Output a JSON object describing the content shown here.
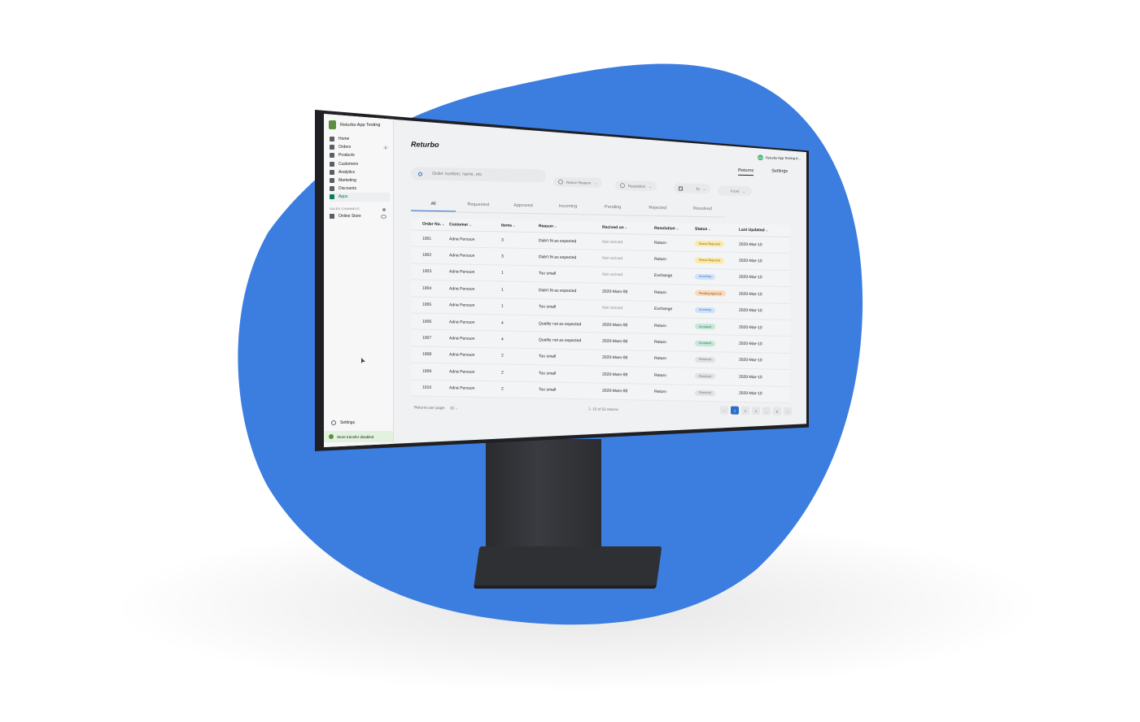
{
  "theme": {
    "blob": "#3c7de0",
    "accent": "#2c6ecb",
    "shopify_green": "#008060"
  },
  "admin": {
    "store_name": "Returbo App Testing",
    "nav": [
      {
        "label": "Home",
        "icon": "home-icon"
      },
      {
        "label": "Orders",
        "icon": "orders-icon",
        "badge": "1"
      },
      {
        "label": "Products",
        "icon": "tag-icon"
      },
      {
        "label": "Customers",
        "icon": "person-icon"
      },
      {
        "label": "Analytics",
        "icon": "bar-chart-icon"
      },
      {
        "label": "Marketing",
        "icon": "megaphone-icon"
      },
      {
        "label": "Discounts",
        "icon": "discount-icon"
      },
      {
        "label": "Apps",
        "icon": "apps-icon",
        "active": true
      }
    ],
    "sales_channels_title": "SALES CHANNELS",
    "online_store": "Online Store",
    "settings": "Settings",
    "transfer_notice": "Store transfer disabled"
  },
  "app": {
    "brand": "Returbo",
    "user_initials": "RA",
    "user_name": "Returbo App Testing A...",
    "top_tabs": [
      "Returns",
      "Settings"
    ],
    "search_placeholder": "Order number, name, etc",
    "filters": {
      "return_reason": "Return Reason",
      "resolution": "Resolution",
      "to": "To",
      "from": "From"
    },
    "tabs": [
      "All",
      "Requested",
      "Approved",
      "Incoming",
      "Pending",
      "Rejected",
      "Resolved"
    ],
    "columns": [
      "Order No.",
      "Customer",
      "Items",
      "Reason",
      "Recived on",
      "Resolution",
      "Status",
      "Last Updated"
    ],
    "rows": [
      {
        "order": "1001",
        "customer": "Adna Persson",
        "items": "3",
        "reason": "Didn't fit as expected",
        "received": "Not recived",
        "resolution": "Return",
        "status": "Return Rejected",
        "updated": "2020-Mar-10"
      },
      {
        "order": "1002",
        "customer": "Adna Persson",
        "items": "3",
        "reason": "Didn't fit as expected",
        "received": "Not recived",
        "resolution": "Return",
        "status": "Return Rejected",
        "updated": "2020-Mar-10"
      },
      {
        "order": "1003",
        "customer": "Adna Persson",
        "items": "1",
        "reason": "Too small",
        "received": "Not recived",
        "resolution": "Exchange",
        "status": "Incoming",
        "updated": "2020-Mar-10"
      },
      {
        "order": "1004",
        "customer": "Adna Persson",
        "items": "1",
        "reason": "Didn't fit as expected",
        "received": "2020-Mars-08",
        "resolution": "Return",
        "status": "Pending Approval",
        "updated": "2020-Mar-10"
      },
      {
        "order": "1005",
        "customer": "Adna Persson",
        "items": "1",
        "reason": "Too small",
        "received": "Not recived",
        "resolution": "Exchange",
        "status": "Incoming",
        "updated": "2020-Mar-10"
      },
      {
        "order": "1006",
        "customer": "Adna Persson",
        "items": "4",
        "reason": "Quality not as expected",
        "received": "2020-Mars-08",
        "resolution": "Return",
        "status": "Accepted",
        "updated": "2020-Mar-10"
      },
      {
        "order": "1007",
        "customer": "Adna Persson",
        "items": "4",
        "reason": "Quality not as expected",
        "received": "2020-Mars-08",
        "resolution": "Return",
        "status": "Accepted",
        "updated": "2020-Mar-10"
      },
      {
        "order": "1008",
        "customer": "Adna Persson",
        "items": "2",
        "reason": "Too small",
        "received": "2020-Mars-08",
        "resolution": "Return",
        "status": "Resolved",
        "updated": "2020-Mar-10"
      },
      {
        "order": "1009",
        "customer": "Adna Persson",
        "items": "2",
        "reason": "Too small",
        "received": "2020-Mars-08",
        "resolution": "Return",
        "status": "Resolved",
        "updated": "2020-Mar-10"
      },
      {
        "order": "1010",
        "customer": "Adna Persson",
        "items": "2",
        "reason": "Too small",
        "received": "2020-Mars-08",
        "resolution": "Return",
        "status": "Resolved",
        "updated": "2020-Mar-10"
      }
    ],
    "status_colors": {
      "Return Rejected": {
        "bg": "#fbe9a6",
        "fg": "#8a6116"
      },
      "Incoming": {
        "bg": "#cfe3f7",
        "fg": "#2c6ecb"
      },
      "Pending Approval": {
        "bg": "#fcd9b8",
        "fg": "#8a4b16"
      },
      "Accepted": {
        "bg": "#c7e6d8",
        "fg": "#1f7a55"
      },
      "Resolved": {
        "bg": "#e1e2e4",
        "fg": "#6d7175"
      }
    },
    "per_page_label": "Returns per page:",
    "per_page_value": "10",
    "range_text": "1- 10 of 53 returns",
    "pages": [
      "1",
      "2",
      "3",
      "...",
      "6"
    ]
  }
}
